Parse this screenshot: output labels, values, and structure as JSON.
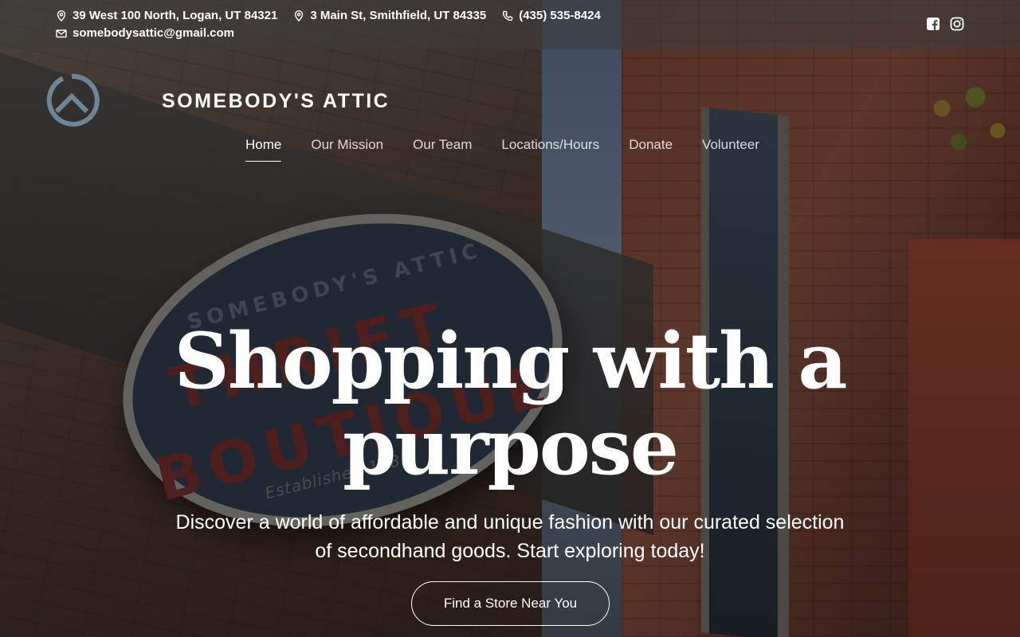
{
  "topbar": {
    "address1": "39 West 100 North, Logan, UT 84321",
    "address2": "3 Main St, Smithfield, UT 84335",
    "phone": "(435) 535-8424",
    "email": "somebodysattic@gmail.com",
    "icons": [
      "map-pin-icon",
      "map-pin-icon",
      "phone-icon",
      "mail-icon"
    ],
    "social": [
      "facebook-icon",
      "instagram-icon"
    ]
  },
  "header": {
    "brand": "SOMEBODY'S ATTIC",
    "logo_icon": "circle-house-logo"
  },
  "nav": {
    "items": [
      {
        "label": "Home",
        "active": true
      },
      {
        "label": "Our Mission",
        "active": false
      },
      {
        "label": "Our Team",
        "active": false
      },
      {
        "label": "Locations/Hours",
        "active": false
      },
      {
        "label": "Donate",
        "active": false
      },
      {
        "label": "Volunteer",
        "active": false
      }
    ]
  },
  "hero": {
    "title": "Shopping with a purpose",
    "subtitle": "Discover a world of affordable and unique fashion with our curated selection of secondhand goods. Start exploring today!",
    "cta_label": "Find a Store Near You",
    "background_sign": {
      "line1": "SOMEBODY'S ATTIC",
      "line2": "THRIFT",
      "line3": "BOUTIQUE",
      "line4": "Established 1985"
    }
  },
  "colors": {
    "overlay": "#000000",
    "text": "#ffffff",
    "logo_stroke": "#6f8596"
  }
}
